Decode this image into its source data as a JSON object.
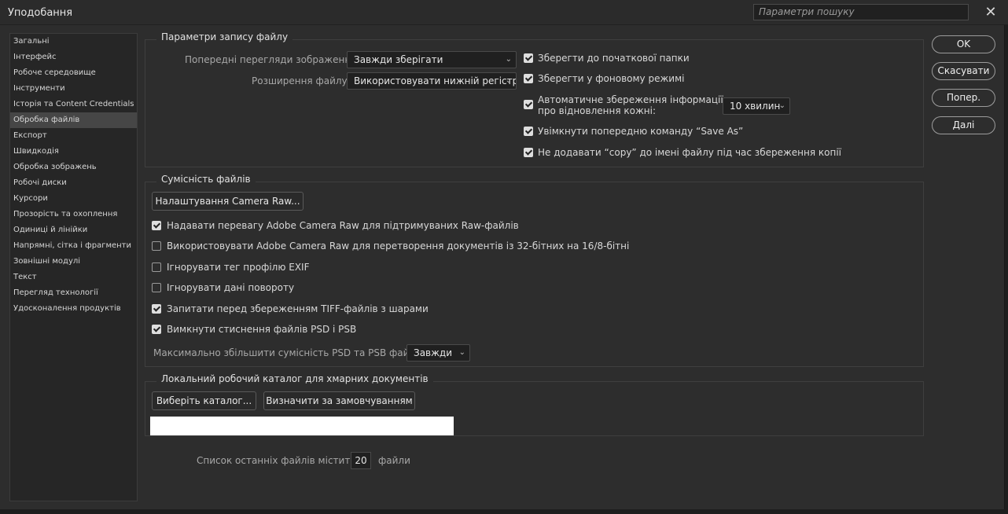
{
  "window": {
    "title": "Уподобання",
    "search_placeholder": "Параметри пошуку"
  },
  "sidebar": {
    "items": [
      {
        "label": "Загальні",
        "active": false
      },
      {
        "label": "Інтерфейс",
        "active": false
      },
      {
        "label": "Робоче середовище",
        "active": false
      },
      {
        "label": "Інструменти",
        "active": false
      },
      {
        "label": "Історія та Content Credentials",
        "active": false
      },
      {
        "label": "Обробка файлів",
        "active": true
      },
      {
        "label": "Експорт",
        "active": false
      },
      {
        "label": "Швидкодія",
        "active": false
      },
      {
        "label": "Обробка зображень",
        "active": false
      },
      {
        "label": "Робочі диски",
        "active": false
      },
      {
        "label": "Курсори",
        "active": false
      },
      {
        "label": "Прозорість та охоплення",
        "active": false
      },
      {
        "label": "Одиниці й лінійки",
        "active": false
      },
      {
        "label": "Напрямні, сітка і фрагменти",
        "active": false
      },
      {
        "label": "Зовнішні модулі",
        "active": false
      },
      {
        "label": "Текст",
        "active": false
      },
      {
        "label": "Перегляд технології",
        "active": false
      },
      {
        "label": "Удосконалення продуктів",
        "active": false
      }
    ]
  },
  "file_saving": {
    "title": "Параметри запису файлу",
    "preview_label": "Попередні перегляди зображення:",
    "preview_value": "Завжди зберігати",
    "extension_label": "Розширення файлу:",
    "extension_value": "Використовувати нижній регістр",
    "save_original_folder": {
      "label": "Зберегти до початкової папки",
      "checked": true
    },
    "save_background": {
      "label": "Зберегти у фоновому режимі",
      "checked": true
    },
    "autosave": {
      "label_line1": "Автоматичне збереження інформації",
      "label_line2": "про відновлення кожні:",
      "checked": true,
      "interval": "10 хвилин"
    },
    "legacy_save_as": {
      "label": "Увімкнути попередню команду “Save As”",
      "checked": true
    },
    "no_copy_suffix": {
      "label": "Не додавати “copy” до імені файлу під час збереження копії",
      "checked": true
    }
  },
  "compatibility": {
    "title": "Сумісність файлів",
    "camera_raw_button": "Налаштування Camera Raw...",
    "options": [
      {
        "label": "Надавати перевагу Adobe Camera Raw для підтримуваних Raw-файлів",
        "checked": true
      },
      {
        "label": "Використовувати Adobe Camera Raw для перетворення документів із 32-бітних на 16/8-бітні",
        "checked": false
      },
      {
        "label": "Ігнорувати тег профілю EXIF",
        "checked": false
      },
      {
        "label": "Ігнорувати дані повороту",
        "checked": false
      },
      {
        "label": "Запитати перед збереженням TIFF-файлів з шарами",
        "checked": true
      },
      {
        "label": "Вимкнути стиснення файлів PSD і PSB",
        "checked": true
      }
    ],
    "maximize_label": "Максимально збільшити сумісність PSD та PSB файлів:",
    "maximize_value": "Завжди"
  },
  "cloud": {
    "title": "Локальний робочий каталог для хмарних документів",
    "choose_button": "Виберіть каталог...",
    "default_button": "Визначити за замовчуванням",
    "path_value": ""
  },
  "recent": {
    "label": "Список останніх файлів містить:",
    "value": "20",
    "suffix": "файли"
  },
  "actions": {
    "ok": "OK",
    "cancel": "Скасувати",
    "prev": "Попер.",
    "next": "Далі"
  }
}
